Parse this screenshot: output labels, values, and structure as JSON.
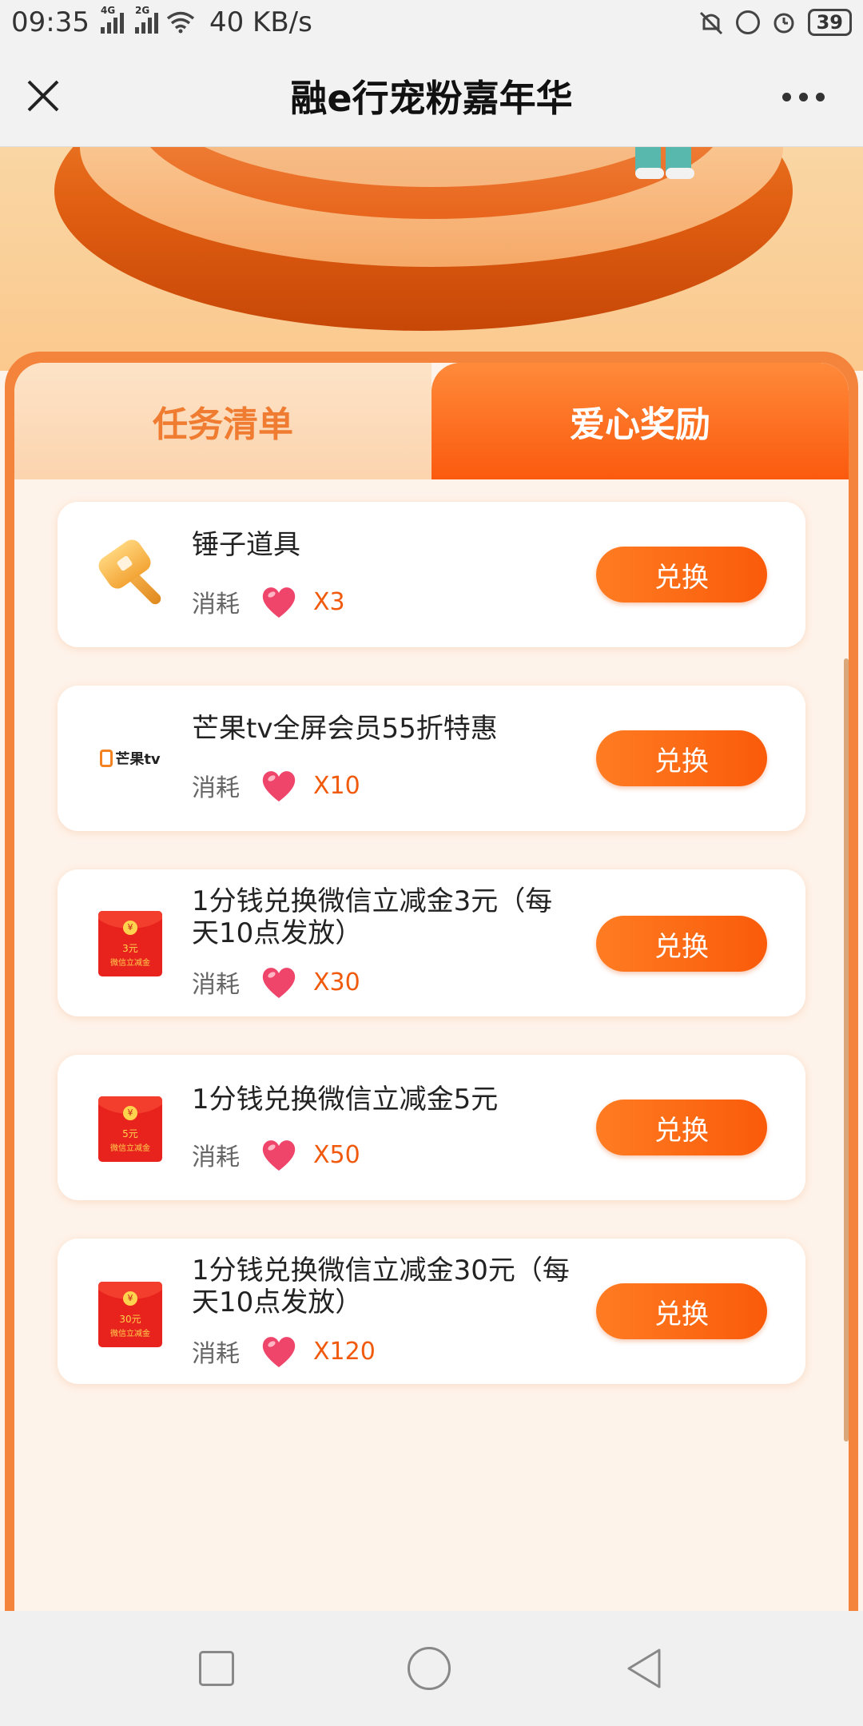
{
  "status_bar": {
    "time": "09:35",
    "signal1": "4G",
    "signal2": "2G",
    "speed": "40 KB/s",
    "battery": "39"
  },
  "nav": {
    "title": "融e行宠粉嘉年华"
  },
  "tabs": [
    {
      "label": "任务清单",
      "active": false
    },
    {
      "label": "爱心奖励",
      "active": true
    }
  ],
  "rewards": [
    {
      "title": "锤子道具",
      "cost_label": "消耗",
      "cost": "X3",
      "button": "兑换",
      "icon": "hammer-icon"
    },
    {
      "title": "芒果tv全屏会员55折特惠",
      "cost_label": "消耗",
      "cost": "X10",
      "button": "兑换",
      "icon": "mango-tv-logo",
      "logo_text": "芒果tv"
    },
    {
      "title": "1分钱兑换微信立减金3元（每天10点发放）",
      "cost_label": "消耗",
      "cost": "X30",
      "button": "兑换",
      "icon": "red-packet-icon",
      "packet_amount": "3元",
      "packet_sub": "微信立减金"
    },
    {
      "title": "1分钱兑换微信立减金5元",
      "cost_label": "消耗",
      "cost": "X50",
      "button": "兑换",
      "icon": "red-packet-icon",
      "packet_amount": "5元",
      "packet_sub": "微信立减金"
    },
    {
      "title": "1分钱兑换微信立减金30元（每天10点发放）",
      "cost_label": "消耗",
      "cost": "X120",
      "button": "兑换",
      "icon": "red-packet-icon",
      "packet_amount": "30元",
      "packet_sub": "微信立减金"
    }
  ],
  "colors": {
    "accent": "#fa5b0a",
    "panel_border": "#f4843c",
    "heart": "#f0456a"
  }
}
